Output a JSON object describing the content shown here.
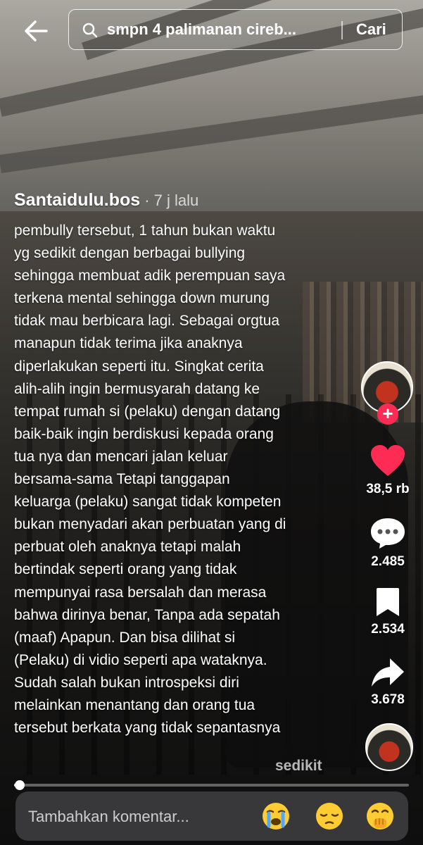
{
  "search": {
    "query": "smpn 4 palimanan cireb...",
    "submit_label": "Cari"
  },
  "post": {
    "author": "Santaidulu.bos",
    "time": "· 7 j lalu",
    "caption_lines": [
      "pembully tersebut, 1 tahun bukan waktu",
      "yg sedikit dengan berbagai bullying",
      "sehingga membuat adik perempuan saya",
      "terkena mental sehingga down murung",
      "tidak mau berbicara lagi. Sebagai orgtua",
      "manapun tidak terima jika anaknya",
      "diperlakukan seperti itu. Singkat cerita",
      "alih-alih ingin bermusyarah datang ke",
      "tempat rumah si (pelaku) dengan datang",
      "baik-baik ingin berdiskusi kepada orang",
      "tua nya dan mencari jalan keluar",
      "bersama-sama Tetapi tanggapan",
      "keluarga (pelaku) sangat tidak kompeten",
      "bukan menyadari akan perbuatan yang di",
      "perbuat oleh anaknya tetapi malah",
      "bertindak seperti orang yang tidak",
      "mempunyai rasa bersalah dan merasa",
      "bahwa dirinya benar, Tanpa ada sepatah",
      "(maaf) Apapun. Dan bisa dilihat si",
      "(Pelaku) di vidio seperti apa wataknya.",
      "Sudah salah bukan introspeksi diri",
      "melainkan menantang dan orang tua",
      "tersebut berkata yang tidak sepantasnya"
    ],
    "less_label": "sedikit"
  },
  "actions": {
    "follow_label": "+",
    "likes": "38,5 rb",
    "comments": "2.485",
    "bookmarks": "2.534",
    "shares": "3.678"
  },
  "playback": {
    "progress": 0.015
  },
  "comment_bar": {
    "placeholder": "Tambahkan komentar...",
    "emojis": [
      "😭",
      "😔",
      "🤭"
    ]
  },
  "colors": {
    "like": "#fe2c55",
    "follow": "#fe2c55",
    "icon": "#ffffff"
  },
  "icons": [
    "back-arrow-icon",
    "search-icon",
    "heart-icon",
    "comment-icon",
    "bookmark-icon",
    "share-icon"
  ]
}
